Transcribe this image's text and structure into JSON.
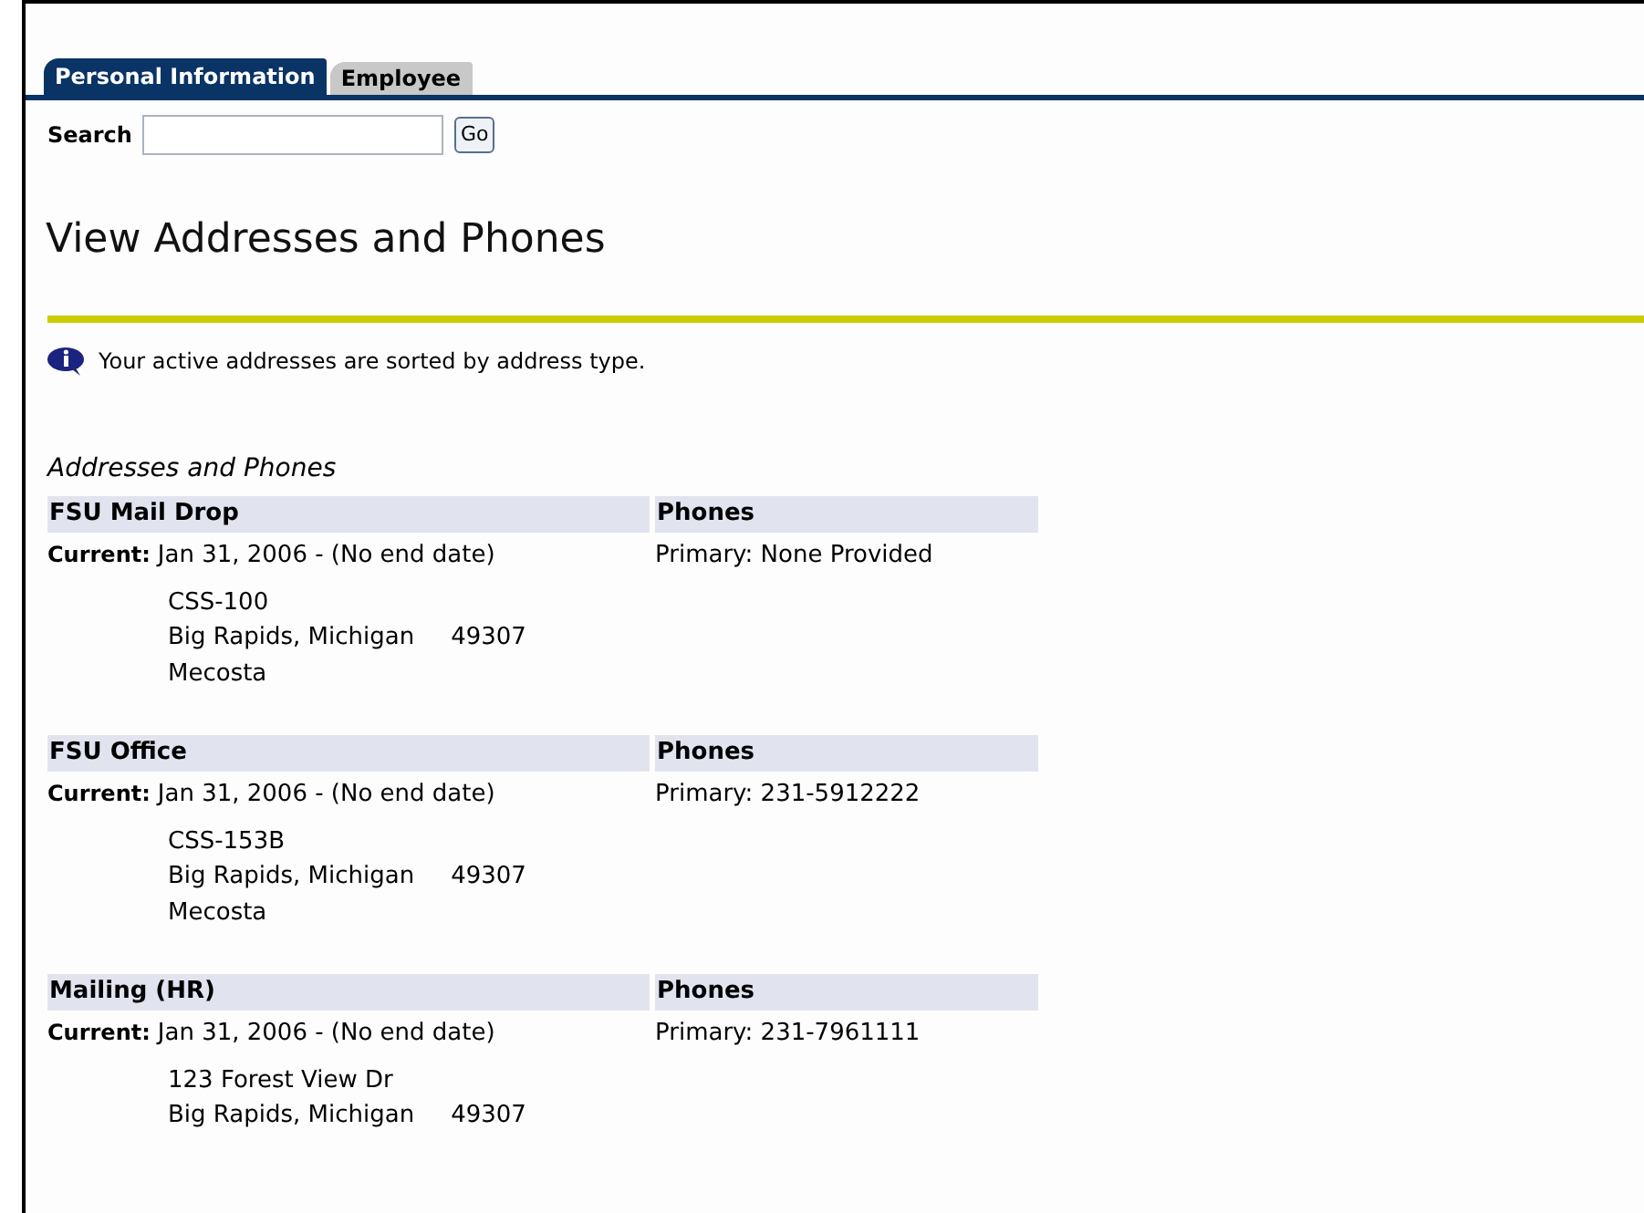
{
  "tabs": [
    {
      "label": "Personal Information",
      "selected": true
    },
    {
      "label": "Employee",
      "selected": false
    }
  ],
  "search": {
    "label": "Search",
    "button": "Go"
  },
  "heading": "View Addresses and Phones",
  "info": "Your active addresses are sorted by address type.",
  "section_title": "Addresses and Phones",
  "addresses": [
    {
      "type": "FSU Mail Drop",
      "phones_heading": "Phones",
      "status": "Current:",
      "dates": "Jan 31, 2006 - (No end date)",
      "phone": "Primary: None Provided",
      "street": "CSS-100",
      "city": "Big Rapids, Michigan",
      "zip": "49307",
      "county": "Mecosta"
    },
    {
      "type": "FSU Office",
      "phones_heading": "Phones",
      "status": "Current:",
      "dates": "Jan 31, 2006 - (No end date)",
      "phone": "Primary: 231-5912222",
      "street": "CSS-153B",
      "city": "Big Rapids, Michigan",
      "zip": "49307",
      "county": "Mecosta"
    },
    {
      "type": "Mailing (HR)",
      "phones_heading": "Phones",
      "status": "Current:",
      "dates": "Jan 31, 2006 - (No end date)",
      "phone": "Primary: 231-7961111",
      "street": "123 Forest View Dr",
      "city": "Big Rapids, Michigan",
      "zip": "49307"
    }
  ]
}
